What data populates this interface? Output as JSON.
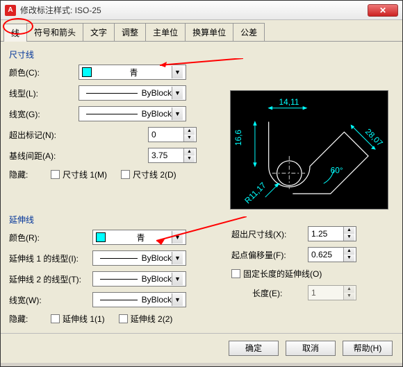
{
  "window": {
    "title": "修改标注样式: ISO-25"
  },
  "tabs": [
    "线",
    "符号和箭头",
    "文字",
    "调整",
    "主单位",
    "换算单位",
    "公差"
  ],
  "dimline": {
    "title": "尺寸线",
    "color_label": "颜色(C):",
    "color_value": "青",
    "linetype_label": "线型(L):",
    "linetype_value": "ByBlock",
    "lineweight_label": "线宽(G):",
    "lineweight_value": "ByBlock",
    "extend_label": "超出标记(N):",
    "extend_value": "0",
    "spacing_label": "基线间距(A):",
    "spacing_value": "3.75",
    "hide_label": "隐藏:",
    "hide1": "尺寸线 1(M)",
    "hide2": "尺寸线 2(D)"
  },
  "extline": {
    "title": "延伸线",
    "color_label": "颜色(R):",
    "color_value": "青",
    "lt1_label": "延伸线 1 的线型(I):",
    "lt1_value": "ByBlock",
    "lt2_label": "延伸线 2 的线型(T):",
    "lt2_value": "ByBlock",
    "lineweight_label": "线宽(W):",
    "lineweight_value": "ByBlock",
    "hide_label": "隐藏:",
    "hide1": "延伸线 1(1)",
    "hide2": "延伸线 2(2)",
    "beyond_label": "超出尺寸线(X):",
    "beyond_value": "1.25",
    "offset_label": "起点偏移量(F):",
    "offset_value": "0.625",
    "fixed_label": "固定长度的延伸线(O)",
    "length_label": "长度(E):",
    "length_value": "1"
  },
  "preview": {
    "d1": "14,11",
    "d2": "16,6",
    "d3": "28,07",
    "d4": "R11,17",
    "d5": "60°"
  },
  "buttons": {
    "ok": "确定",
    "cancel": "取消",
    "help": "帮助(H)"
  }
}
